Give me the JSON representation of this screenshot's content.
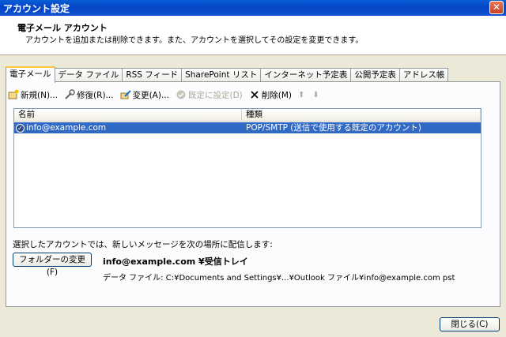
{
  "window": {
    "title": "アカウント設定",
    "close_glyph": "✕"
  },
  "header": {
    "title": "電子メール アカウント",
    "description": "アカウントを追加または削除できます。また、アカウントを選択してその設定を変更できます。"
  },
  "tabs": [
    {
      "label": "電子メール",
      "active": true
    },
    {
      "label": "データ ファイル"
    },
    {
      "label": "RSS フィード"
    },
    {
      "label": "SharePoint リスト"
    },
    {
      "label": "インターネット予定表"
    },
    {
      "label": "公開予定表"
    },
    {
      "label": "アドレス帳"
    }
  ],
  "toolbar": {
    "new_label": "新規(N)...",
    "repair_label": "修復(R)...",
    "change_label": "変更(A)...",
    "default_label": "既定に設定(D)",
    "delete_label": "削除(M)",
    "up_glyph": "⬆",
    "down_glyph": "⬇",
    "icons": [
      "new-icon",
      "repair-icon",
      "change-icon",
      "default-icon",
      "delete-icon",
      "up-arrow-icon",
      "down-arrow-icon"
    ]
  },
  "list": {
    "col_name": "名前",
    "col_type": "種類",
    "rows": [
      {
        "name": "info@example.com",
        "type": "POP/SMTP (送信で使用する既定のアカウント)",
        "selected": true
      }
    ]
  },
  "delivery": {
    "label": "選択したアカウントでは、新しいメッセージを次の場所に配信します:",
    "folder_button": "フォルダーの変更(F)",
    "folder": "info@example.com ¥受信トレイ",
    "data_file": "データ ファイル: C:¥Documents and Settings¥...¥Outlook ファイル¥info@example.com pst"
  },
  "footer": {
    "close_label": "閉じる(C)"
  },
  "colors": {
    "selection": "#316ac5",
    "titlebar": "#0346c9",
    "dialog_bg": "#ece9d8"
  }
}
